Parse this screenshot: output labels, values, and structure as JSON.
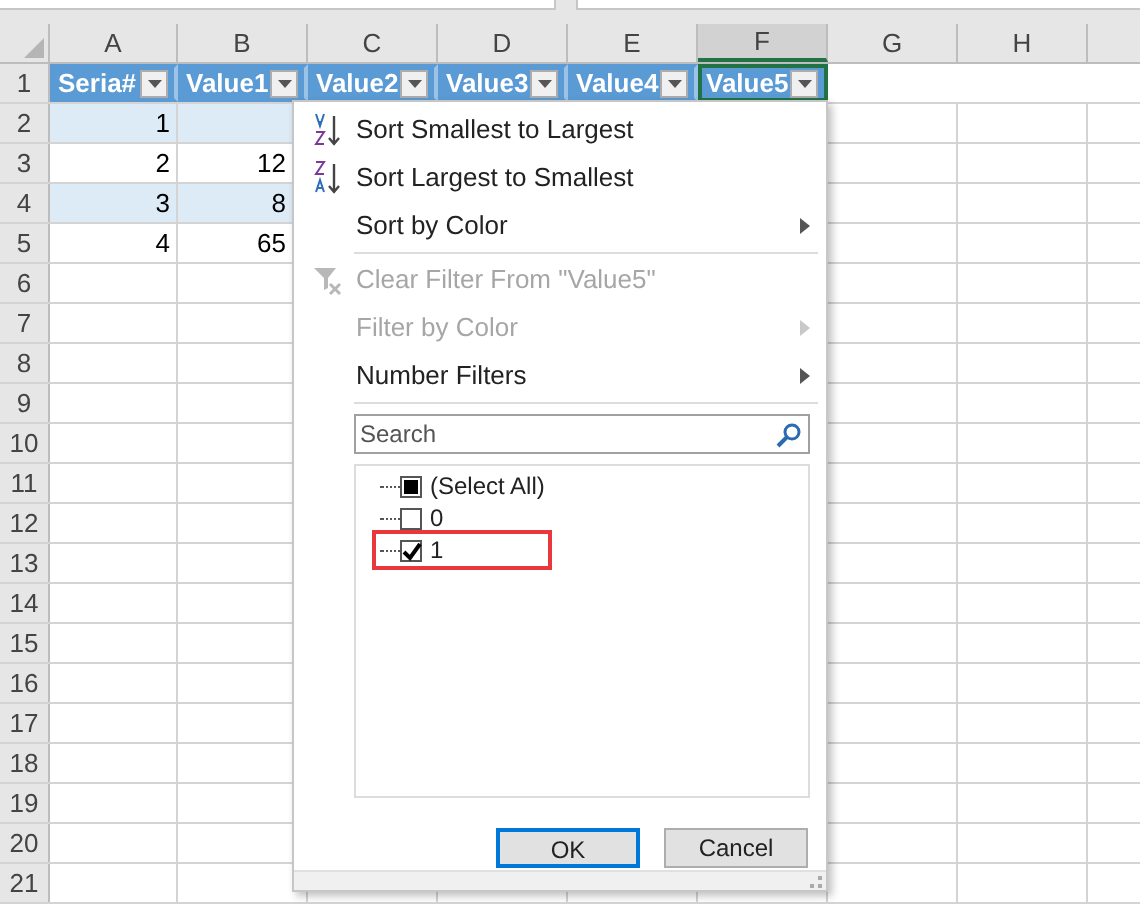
{
  "columns": [
    {
      "label": "A",
      "selected": false
    },
    {
      "label": "B",
      "selected": false
    },
    {
      "label": "C",
      "selected": false
    },
    {
      "label": "D",
      "selected": false
    },
    {
      "label": "E",
      "selected": false
    },
    {
      "label": "F",
      "selected": true
    },
    {
      "label": "G",
      "selected": false
    },
    {
      "label": "H",
      "selected": false
    }
  ],
  "header_row": [
    {
      "label": "Seria#",
      "selected": false
    },
    {
      "label": "Value1",
      "selected": false
    },
    {
      "label": "Value2",
      "selected": false
    },
    {
      "label": "Value3",
      "selected": false
    },
    {
      "label": "Value4",
      "selected": false
    },
    {
      "label": "Value5",
      "selected": true
    }
  ],
  "rows": [
    {
      "number": "1"
    },
    {
      "number": "2",
      "cells": [
        "1",
        ""
      ],
      "banded": true
    },
    {
      "number": "3",
      "cells": [
        "2",
        "12"
      ],
      "banded": false
    },
    {
      "number": "4",
      "cells": [
        "3",
        "8"
      ],
      "banded": true
    },
    {
      "number": "5",
      "cells": [
        "4",
        "65"
      ],
      "banded": false
    },
    {
      "number": "6"
    },
    {
      "number": "7"
    },
    {
      "number": "8"
    },
    {
      "number": "9"
    },
    {
      "number": "10"
    },
    {
      "number": "11"
    },
    {
      "number": "12"
    },
    {
      "number": "13"
    },
    {
      "number": "14"
    },
    {
      "number": "15"
    },
    {
      "number": "16"
    },
    {
      "number": "17"
    },
    {
      "number": "18"
    },
    {
      "number": "19"
    },
    {
      "number": "20"
    },
    {
      "number": "21"
    }
  ],
  "filter_menu": {
    "items": [
      {
        "label": "Sort Smallest to Largest",
        "disabled": false,
        "submenu": false
      },
      {
        "label": "Sort Largest to Smallest",
        "disabled": false,
        "submenu": false
      },
      {
        "label": "Sort by Color",
        "disabled": false,
        "submenu": true,
        "separator_after": true
      },
      {
        "label": "Clear Filter From \"Value5\"",
        "disabled": true,
        "submenu": false
      },
      {
        "label": "Filter by Color",
        "disabled": true,
        "submenu": true
      },
      {
        "label": "Number Filters",
        "disabled": false,
        "submenu": true,
        "separator_after": true
      }
    ],
    "search": {
      "placeholder": "Search"
    },
    "values": [
      {
        "label": "(Select All)",
        "checked": false,
        "indeterminate": true,
        "highlighted": false
      },
      {
        "label": "0",
        "checked": false,
        "highlighted": false
      },
      {
        "label": "1",
        "checked": true,
        "highlighted": true
      }
    ],
    "buttons": [
      {
        "label": "OK",
        "default": true
      },
      {
        "label": "Cancel",
        "default": false
      }
    ]
  }
}
